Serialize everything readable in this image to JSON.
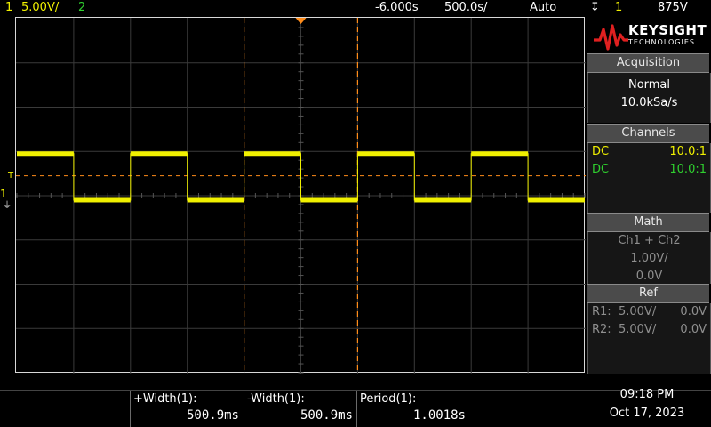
{
  "topbar": {
    "ch1_num": "1",
    "ch1_scale": "5.00V/",
    "ch2_num": "2",
    "time_offset": "-6.000s",
    "timebase": "500.0s/",
    "trigger_mode": "Auto",
    "trigger_source": "1",
    "trigger_level": "875V"
  },
  "panel": {
    "brand": "KEYSIGHT",
    "brand_sub": "TECHNOLOGIES",
    "acquisition": {
      "header": "Acquisition",
      "mode": "Normal",
      "rate": "10.0kSa/s"
    },
    "channels": {
      "header": "Channels",
      "rows": [
        {
          "coupling": "DC",
          "probe": "10.0:1"
        },
        {
          "coupling": "DC",
          "probe": "10.0:1"
        }
      ]
    },
    "math": {
      "header": "Math",
      "expr": "Ch1 + Ch2",
      "scale": "1.00V/",
      "offset": "0.0V"
    },
    "ref": {
      "header": "Ref",
      "rows": [
        {
          "name": "R1:",
          "scale": "5.00V/",
          "offset": "0.0V"
        },
        {
          "name": "R2:",
          "scale": "5.00V/",
          "offset": "0.0V"
        }
      ]
    }
  },
  "ground_marker": "1",
  "trigger_marker": "T",
  "measurements": [
    {
      "label": "+Width(1):",
      "value": "500.9ms"
    },
    {
      "label": "-Width(1):",
      "value": "500.9ms"
    },
    {
      "label": "Period(1):",
      "value": "1.0018s"
    }
  ],
  "clock": {
    "time": "09:18 PM",
    "date": "Oct 17, 2023"
  },
  "colors": {
    "ch1": "#f0f000",
    "ch2": "#2fd02f",
    "cursor": "#ff8c1a",
    "grid": "#3a3a3a"
  },
  "waveform": {
    "period_s": 1.0018,
    "high_width_s": 0.5009,
    "levels": [
      1,
      0,
      1,
      0,
      1,
      0,
      1,
      0,
      1,
      0
    ]
  }
}
